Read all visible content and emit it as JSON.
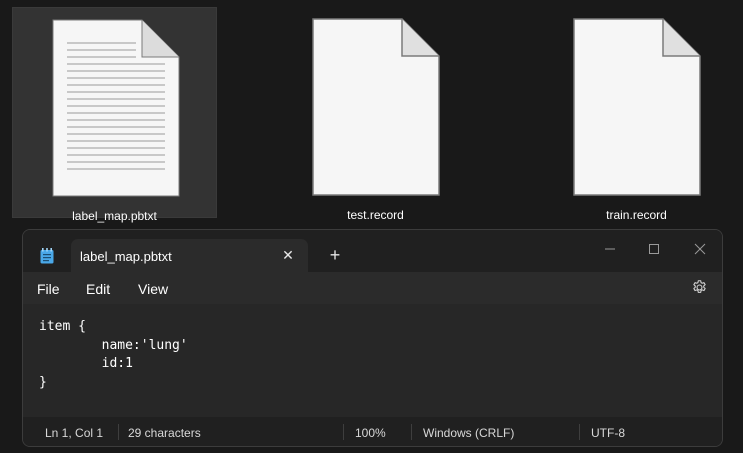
{
  "explorer": {
    "files": [
      {
        "name": "label_map.pbtxt",
        "type": "text-document",
        "selected": true
      },
      {
        "name": "test.record",
        "type": "blank-document",
        "selected": false
      },
      {
        "name": "train.record",
        "type": "blank-document",
        "selected": false
      }
    ]
  },
  "notepad": {
    "tab": {
      "title": "label_map.pbtxt",
      "close_glyph": "✕"
    },
    "new_tab_glyph": "+",
    "menu": {
      "file": "File",
      "edit": "Edit",
      "view": "View"
    },
    "content": "item {\n        name:'lung'\n        id:1\n}",
    "status": {
      "position": "Ln 1, Col 1",
      "characters": "29 characters",
      "zoom": "100%",
      "line_ending": "Windows (CRLF)",
      "encoding": "UTF-8"
    },
    "colors": {
      "accent_icon": "#4aa8e8",
      "editor_bg": "#272727",
      "menubar_bg": "#2b2b2b"
    }
  }
}
